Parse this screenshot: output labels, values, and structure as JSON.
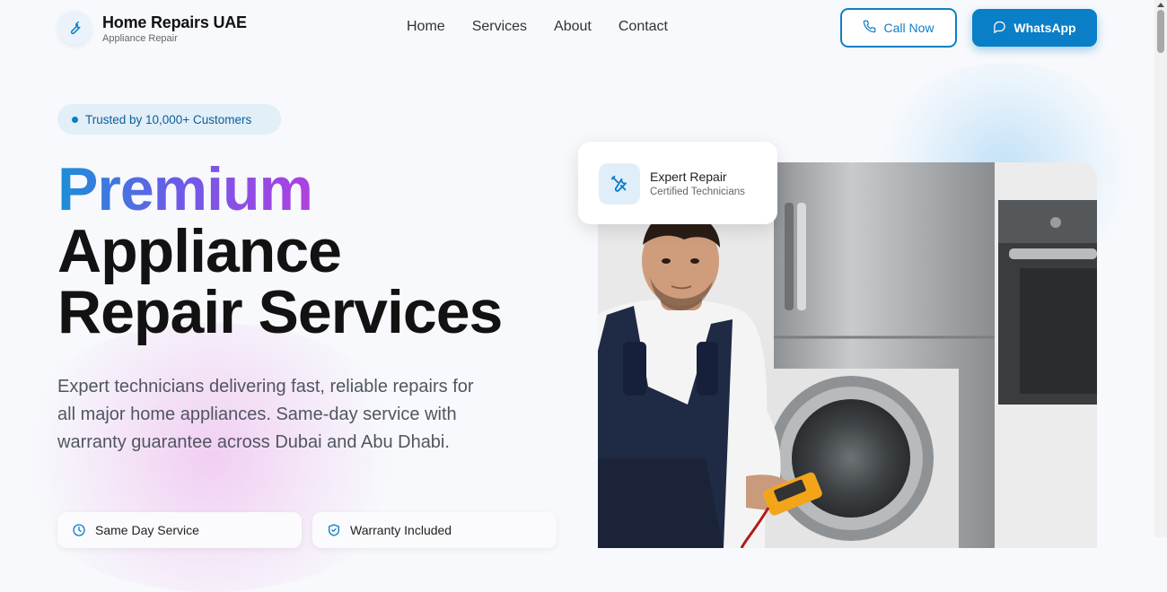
{
  "brand": {
    "name": "Home Repairs UAE",
    "tagline": "Appliance Repair",
    "icon": "wrench-icon"
  },
  "nav": {
    "items": [
      {
        "label": "Home"
      },
      {
        "label": "Services"
      },
      {
        "label": "About"
      },
      {
        "label": "Contact"
      }
    ]
  },
  "header_actions": {
    "call_label": "Call Now",
    "call_icon": "phone-icon",
    "whatsapp_label": "WhatsApp",
    "whatsapp_icon": "chat-icon"
  },
  "hero": {
    "badge": "Trusted by 10,000+ Customers",
    "title_line1": "Premium",
    "title_line2": "Appliance",
    "title_line3": "Repair Services",
    "description": "Expert technicians delivering fast, reliable repairs for all major home appliances. Same-day service with warranty guarantee across Dubai and Abu Dhabi.",
    "features": [
      {
        "label": "Same Day Service",
        "icon": "clock-icon"
      },
      {
        "label": "Warranty Included",
        "icon": "shield-check-icon"
      }
    ]
  },
  "expert_card": {
    "title": "Expert Repair",
    "subtitle": "Certified Technicians",
    "icon": "tools-icon"
  },
  "colors": {
    "primary": "#0a7ec7",
    "gradient_start": "#1a8fd8",
    "gradient_end": "#b040e0",
    "heading": "#121212",
    "background": "#f7f9fc"
  }
}
